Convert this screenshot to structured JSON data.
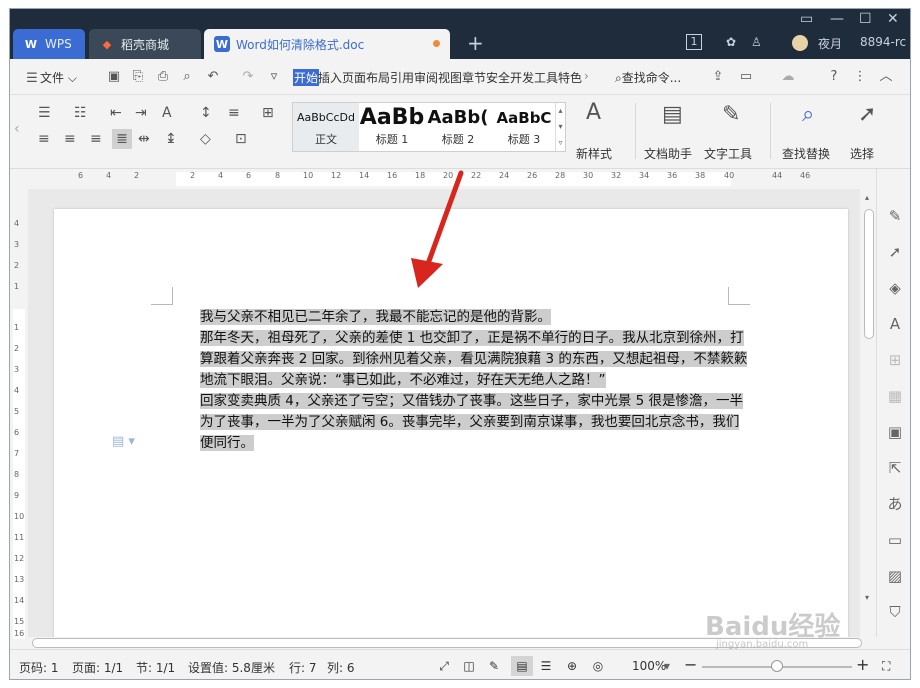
{
  "window": {
    "controls": [
      "▭",
      "—",
      "☐",
      "✕"
    ]
  },
  "tabs": [
    {
      "label": "WPS",
      "icon": "wps-logo-icon"
    },
    {
      "label": "稻壳商城",
      "icon": "docer-flame-icon"
    },
    {
      "label": "Word如何清除格式.doc",
      "icon": "word-doc-icon"
    }
  ],
  "titlebar_right": {
    "badge": "1",
    "user": "夜月",
    "account": "8894-rc"
  },
  "menu": {
    "file_label": "文件",
    "tabs": [
      "开始",
      "插入",
      "页面布局",
      "引用",
      "审阅",
      "视图",
      "章节",
      "安全",
      "开发工具",
      "特色"
    ],
    "search_label": "查找命令..."
  },
  "ribbon": {
    "styles": [
      {
        "preview": "AaBbCcDd",
        "label": "正文"
      },
      {
        "preview": "AaBb",
        "label": "标题 1"
      },
      {
        "preview": "AaBb(",
        "label": "标题 2"
      },
      {
        "preview": "AaBbC",
        "label": "标题 3"
      }
    ],
    "new_style_label": "新样式",
    "doc_helper_label": "文档助手",
    "text_tools_label": "文字工具",
    "find_replace_label": "查找替换",
    "select_label": "选择"
  },
  "ruler": {
    "h_ticks": [
      "6",
      "4",
      "2",
      "2",
      "4",
      "6",
      "8",
      "10",
      "12",
      "14",
      "16",
      "18",
      "20",
      "22",
      "24",
      "26",
      "28",
      "30",
      "32",
      "34",
      "36",
      "38",
      "40",
      "44",
      "46"
    ],
    "v_ticks": [
      "4",
      "3",
      "2",
      "1",
      "1",
      "2",
      "3",
      "4",
      "5",
      "6",
      "7",
      "8",
      "9",
      "10",
      "11",
      "12",
      "13",
      "14",
      "15",
      "16"
    ]
  },
  "document": {
    "lines": [
      "我与父亲不相见已二年余了，我最不能忘记的是他的背影。",
      "那年冬天，祖母死了，父亲的差使 1 也交卸了，正是祸不单行的日子。我从北京到徐州，打",
      "算跟着父亲奔丧 2 回家。到徐州见着父亲，看见满院狼藉 3 的东西，又想起祖母，不禁簌簌",
      "地流下眼泪。父亲说：“事已如此，不必难过，好在天无绝人之路！”",
      "回家变卖典质 4，父亲还了亏空；又借钱办了丧事。这些日子，家中光景 5 很是惨澹，一半",
      "为了丧事，一半为了父亲赋闲 6。丧事完毕，父亲要到南京谋事，我也要回北京念书，我们",
      "便同行。"
    ]
  },
  "status": {
    "page_no": "页码: 1",
    "pages": "页面: 1/1",
    "section": "节: 1/1",
    "setting": "设置值: 5.8厘米",
    "row": "行: 7",
    "col": "列: 6",
    "zoom": "100%"
  },
  "watermark": {
    "text": "Baidu经验",
    "subtext": "jingyan.baidu.com"
  },
  "colors": {
    "accent": "#3b6cd4",
    "titlebar": "#1f2c3c",
    "selection": "#cdcdcd",
    "arrow": "#d8261f"
  }
}
